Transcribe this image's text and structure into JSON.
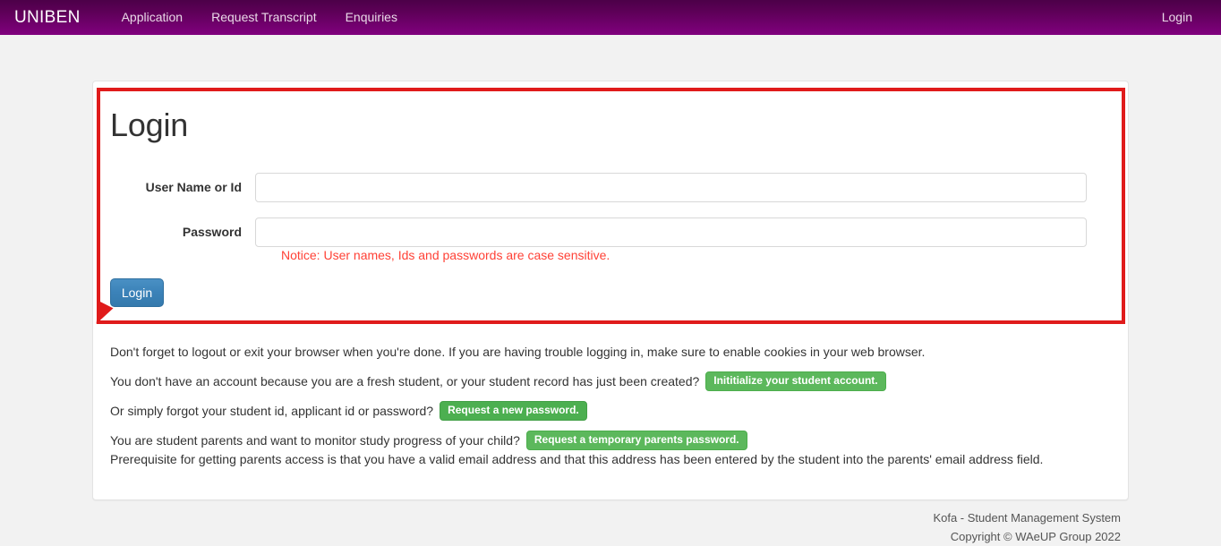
{
  "navbar": {
    "brand": "UNIBEN",
    "links": [
      {
        "label": "Application"
      },
      {
        "label": "Request Transcript"
      },
      {
        "label": "Enquiries"
      }
    ],
    "right_link": "Login",
    "gradient_top": "#4c0048",
    "gradient_bottom": "#80007e"
  },
  "login": {
    "heading": "Login",
    "fields": [
      {
        "label": "User Name or Id",
        "value": "",
        "placeholder": ""
      },
      {
        "label": "Password",
        "value": "",
        "placeholder": ""
      }
    ],
    "notice": "Notice: User names, Ids and passwords are case sensitive.",
    "notice_color": "#ff4136",
    "submit_label": "Login",
    "submit_color": "#3b82b8"
  },
  "annotation": {
    "color": "#e01b1b",
    "shape": "rectangle-with-arrow"
  },
  "info": {
    "line1": "Don't forget to logout or exit your browser when you're done. If you are having trouble logging in, make sure to enable cookies in your web browser.",
    "line2_text": "You don't have an account because you are a fresh student, or your student record has just been created?",
    "line2_badge": "Inititialize your student account.",
    "line3_text": "Or simply forgot your student id, applicant id or password?",
    "line3_badge": "Request a new password.",
    "line4_text": "You are student parents and want to monitor study progress of your child?",
    "line4_badge": "Request a temporary parents password.",
    "line5": "Prerequisite for getting parents access is that you have a valid email address and that this address has been entered by the student into the parents' email address field.",
    "badge_color": "#5cb85c"
  },
  "footer": {
    "line1": "Kofa - Student Management System",
    "line2": "Copyright © WAeUP Group 2022"
  }
}
